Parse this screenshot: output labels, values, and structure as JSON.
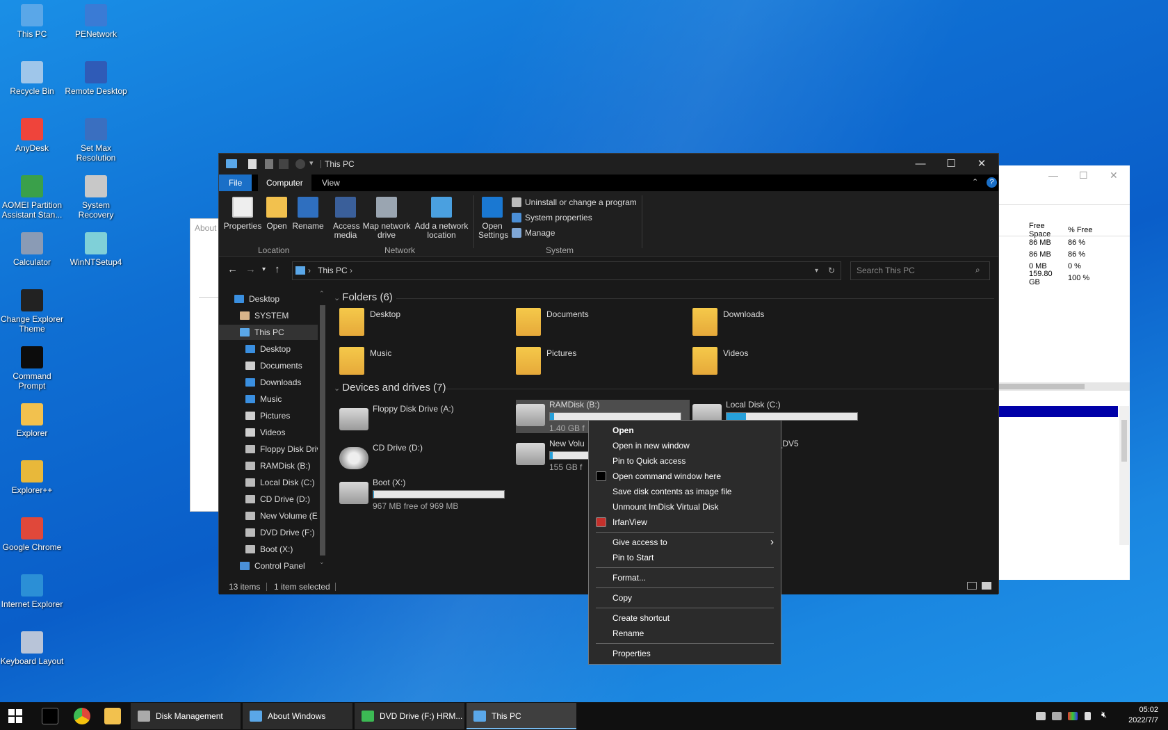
{
  "desktop": {
    "icons": [
      {
        "label": "This PC",
        "icon": "this-pc-icon",
        "color": "#5aa7e8"
      },
      {
        "label": "PENetwork",
        "icon": "network-icon",
        "color": "#3a7bd5"
      },
      {
        "label": "Recycle Bin",
        "icon": "recycle-bin-icon",
        "color": "#9fc6ea"
      },
      {
        "label": "Remote Desktop",
        "icon": "remote-desktop-icon",
        "color": "#2f5bb7"
      },
      {
        "label": "AnyDesk",
        "icon": "anydesk-icon",
        "color": "#ef443b"
      },
      {
        "label": "Set Max Resolution",
        "icon": "monitor-icon",
        "color": "#3a6fc0"
      },
      {
        "label": "AOMEI Partition Assistant Stan...",
        "icon": "partition-icon",
        "color": "#3aa04a"
      },
      {
        "label": "System Recovery",
        "icon": "recovery-icon",
        "color": "#c8c8c8"
      },
      {
        "label": "Calculator",
        "icon": "calculator-icon",
        "color": "#8a9bb5"
      },
      {
        "label": "WinNTSetup4",
        "icon": "setup-icon",
        "color": "#7fd0d8"
      },
      {
        "label": "Change Explorer Theme",
        "icon": "theme-icon",
        "color": "#222222"
      },
      {
        "label": "Command Prompt",
        "icon": "cmd-icon",
        "color": "#0c0c0c"
      },
      {
        "label": "Explorer",
        "icon": "folder-icon",
        "color": "#f2c14e"
      },
      {
        "label": "Explorer++",
        "icon": "folder-icon",
        "color": "#e8b83a"
      },
      {
        "label": "Google Chrome",
        "icon": "chrome-icon",
        "color": "#e0483a"
      },
      {
        "label": "Internet Explorer",
        "icon": "ie-icon",
        "color": "#2b8fd6"
      },
      {
        "label": "Keyboard Layout",
        "icon": "keyboard-icon",
        "color": "#b8c4d8"
      }
    ]
  },
  "backwin": {
    "col_free": "Free Space",
    "col_pct": "% Free",
    "rows": [
      {
        "free": "86 MB",
        "pct": "86 %"
      },
      {
        "free": "86 MB",
        "pct": "86 %"
      },
      {
        "free": "0 MB",
        "pct": "0 %"
      },
      {
        "free": "159.80 GB",
        "pct": "100 %"
      }
    ]
  },
  "aboutwin": {
    "title": "About"
  },
  "explorer": {
    "title": "This PC",
    "tabs": [
      "File",
      "Computer",
      "View"
    ],
    "ribbon": {
      "buttons": [
        {
          "label": "Properties"
        },
        {
          "label": "Open"
        },
        {
          "label": "Rename"
        },
        {
          "label": "Access media"
        },
        {
          "label": "Map network drive"
        },
        {
          "label": "Add a network location"
        },
        {
          "label": "Open Settings"
        }
      ],
      "groups": [
        "Location",
        "Network",
        "System"
      ],
      "system_links": [
        "Uninstall or change a program",
        "System properties",
        "Manage"
      ]
    },
    "address": "This PC",
    "search_placeholder": "Search This PC",
    "nav": [
      {
        "label": "Desktop",
        "indent": 0,
        "color": "#3a8fe0"
      },
      {
        "label": "SYSTEM",
        "indent": 1,
        "color": "#d8b48a"
      },
      {
        "label": "This PC",
        "indent": 1,
        "color": "#5aa7e8",
        "selected": true
      },
      {
        "label": "Desktop",
        "indent": 2,
        "color": "#3a8fe0"
      },
      {
        "label": "Documents",
        "indent": 2,
        "color": "#cfcfcf"
      },
      {
        "label": "Downloads",
        "indent": 2,
        "color": "#3a8fe0"
      },
      {
        "label": "Music",
        "indent": 2,
        "color": "#3a8fe0"
      },
      {
        "label": "Pictures",
        "indent": 2,
        "color": "#cfcfcf"
      },
      {
        "label": "Videos",
        "indent": 2,
        "color": "#cfcfcf"
      },
      {
        "label": "Floppy Disk Drive (A:)",
        "indent": 2,
        "color": "#bbbbbb"
      },
      {
        "label": "RAMDisk (B:)",
        "indent": 2,
        "color": "#bbbbbb"
      },
      {
        "label": "Local Disk (C:)",
        "indent": 2,
        "color": "#bbbbbb"
      },
      {
        "label": "CD Drive (D:)",
        "indent": 2,
        "color": "#bbbbbb"
      },
      {
        "label": "New Volume (E:)",
        "indent": 2,
        "color": "#bbbbbb"
      },
      {
        "label": "DVD Drive (F:) HRM",
        "indent": 2,
        "color": "#bbbbbb"
      },
      {
        "label": "Boot (X:)",
        "indent": 2,
        "color": "#bbbbbb"
      },
      {
        "label": "Control Panel",
        "indent": 1,
        "color": "#4a90d9"
      }
    ],
    "folders_header": "Folders (6)",
    "folders": [
      "Desktop",
      "Documents",
      "Downloads",
      "Music",
      "Pictures",
      "Videos"
    ],
    "drives_header": "Devices and drives (7)",
    "drives": [
      {
        "name": "Floppy Disk Drive (A:)",
        "kind": "floppy"
      },
      {
        "name": "RAMDisk (B:)",
        "free": "1.40 GB f",
        "used_fraction": 0.03,
        "kind": "hdd",
        "selected": true
      },
      {
        "name": "Local Disk (C:)",
        "free": "of 99.9 MB",
        "used_fraction": 0.15,
        "kind": "hdd"
      },
      {
        "name": "CD Drive (D:)",
        "kind": "cd"
      },
      {
        "name": "New Volu",
        "free": "155 GB f",
        "used_fraction": 0.02,
        "kind": "hdd"
      },
      {
        "name": "4FRE_EN-US_DV5",
        "free": "of 3.44 GB",
        "kind": "dvd"
      },
      {
        "name": "Boot (X:)",
        "free": "967 MB free of 969 MB",
        "used_fraction": 0.002,
        "kind": "hdd"
      }
    ],
    "status": {
      "items": "13 items",
      "selected": "1 item selected"
    }
  },
  "context_menu": {
    "items": [
      {
        "label": "Open",
        "bold": true
      },
      {
        "label": "Open in new window"
      },
      {
        "label": "Pin to Quick access"
      },
      {
        "label": "Open command window here",
        "icon": "cmd-icon"
      },
      {
        "label": "Save disk contents as image file"
      },
      {
        "label": "Unmount ImDisk Virtual Disk"
      },
      {
        "label": "IrfanView",
        "icon": "irfanview-icon"
      },
      {
        "label": "Give access to",
        "submenu": true
      },
      {
        "label": "Pin to Start"
      },
      {
        "label": "Format..."
      },
      {
        "label": "Copy"
      },
      {
        "label": "Create shortcut"
      },
      {
        "label": "Rename"
      },
      {
        "label": "Properties"
      }
    ]
  },
  "taskbar": {
    "tasks": [
      {
        "label": "Disk Management"
      },
      {
        "label": "About Windows"
      },
      {
        "label": "DVD Drive (F:) HRM..."
      },
      {
        "label": "This PC",
        "active": true
      }
    ],
    "clock_time": "05:02",
    "clock_date": "2022/7/7"
  }
}
